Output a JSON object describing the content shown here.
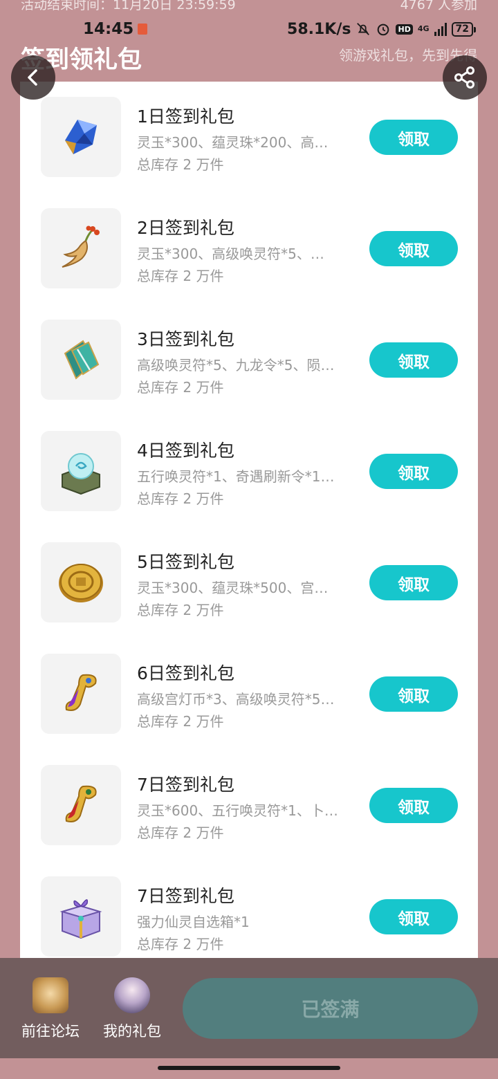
{
  "topinfo": {
    "left": "活动结束时间：11月20日 23:59:59",
    "right": "4767 人参加"
  },
  "status": {
    "time": "14:45",
    "speed": "58.1K/s",
    "net": "4G",
    "battery": "72"
  },
  "header": {
    "title": "签到领礼包",
    "subtitle": "领游戏礼包，先到先得"
  },
  "items": [
    {
      "title": "1日签到礼包",
      "desc": "灵玉*300、蕴灵珠*200、高…",
      "stock": "总库存 2 万件",
      "button": "领取",
      "icon": "blue-crystal-icon"
    },
    {
      "title": "2日签到礼包",
      "desc": "灵玉*300、高级唤灵符*5、…",
      "stock": "总库存 2 万件",
      "button": "领取",
      "icon": "ginseng-icon"
    },
    {
      "title": "3日签到礼包",
      "desc": "高级唤灵符*5、九龙令*5、陨…",
      "stock": "总库存 2 万件",
      "button": "领取",
      "icon": "talisman-scroll-icon"
    },
    {
      "title": "4日签到礼包",
      "desc": "五行唤灵符*1、奇遇刷新令*1…",
      "stock": "总库存 2 万件",
      "button": "领取",
      "icon": "orb-pedestal-icon"
    },
    {
      "title": "5日签到礼包",
      "desc": "灵玉*300、蕴灵珠*500、宫…",
      "stock": "总库存 2 万件",
      "button": "领取",
      "icon": "gold-coin-icon"
    },
    {
      "title": "6日签到礼包",
      "desc": "高级宫灯币*3、高级唤灵符*5…",
      "stock": "总库存 2 万件",
      "button": "领取",
      "icon": "purple-ruyi-icon"
    },
    {
      "title": "7日签到礼包",
      "desc": "灵玉*600、五行唤灵符*1、卜…",
      "stock": "总库存 2 万件",
      "button": "领取",
      "icon": "red-ruyi-icon"
    },
    {
      "title": "7日签到礼包",
      "desc": "强力仙灵自选箱*1",
      "stock": "总库存 2 万件",
      "button": "领取",
      "icon": "gift-box-icon"
    }
  ],
  "bottom": {
    "forum": "前往论坛",
    "mygifts": "我的礼包",
    "signed": "已签满"
  }
}
